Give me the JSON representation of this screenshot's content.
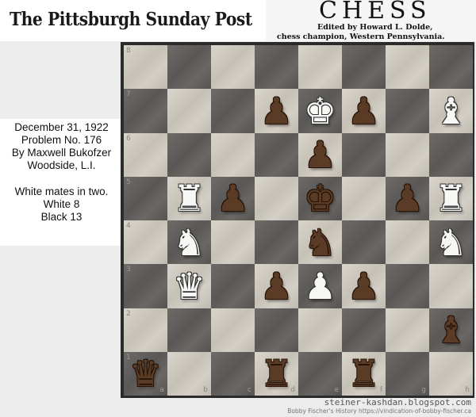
{
  "header": {
    "masthead": "The Pittsburgh Sunday Post",
    "chess_title": "CHESS",
    "edited_by": "Edited by Howard L. Dolde,",
    "champion": "chess champion, Western Pennsylvania."
  },
  "problem": {
    "date": "December 31, 1922",
    "number": "Problem No. 176",
    "author": "By Maxwell Bukofzer",
    "location": "Woodside, L.I.",
    "stipulation": "White mates in two.",
    "white_count": "White 8",
    "black_count": "Black 13"
  },
  "board": {
    "rank_labels": [
      "8",
      "7",
      "6",
      "5",
      "4",
      "3",
      "2",
      "1"
    ],
    "file_labels": [
      "a",
      "b",
      "c",
      "d",
      "e",
      "f",
      "g",
      "h"
    ],
    "light_color": "#d0ccc2",
    "dark_color": "#63605d",
    "pieces": [
      {
        "square": "d7",
        "color": "black",
        "type": "pawn",
        "glyph": "♟"
      },
      {
        "square": "e7",
        "color": "white",
        "type": "king",
        "glyph": "♚"
      },
      {
        "square": "f7",
        "color": "black",
        "type": "pawn",
        "glyph": "♟"
      },
      {
        "square": "h7",
        "color": "white",
        "type": "bishop",
        "glyph": "♝"
      },
      {
        "square": "e6",
        "color": "black",
        "type": "pawn",
        "glyph": "♟"
      },
      {
        "square": "b5",
        "color": "white",
        "type": "rook",
        "glyph": "♜"
      },
      {
        "square": "c5",
        "color": "black",
        "type": "pawn",
        "glyph": "♟"
      },
      {
        "square": "e5",
        "color": "black",
        "type": "king",
        "glyph": "♚"
      },
      {
        "square": "g5",
        "color": "black",
        "type": "pawn",
        "glyph": "♟"
      },
      {
        "square": "h5",
        "color": "white",
        "type": "rook",
        "glyph": "♜"
      },
      {
        "square": "b4",
        "color": "white",
        "type": "knight",
        "glyph": "♞"
      },
      {
        "square": "e4",
        "color": "black",
        "type": "knight",
        "glyph": "♞"
      },
      {
        "square": "h4",
        "color": "white",
        "type": "knight",
        "glyph": "♞"
      },
      {
        "square": "b3",
        "color": "white",
        "type": "queen",
        "glyph": "♛"
      },
      {
        "square": "d3",
        "color": "black",
        "type": "pawn",
        "glyph": "♟"
      },
      {
        "square": "e3",
        "color": "white",
        "type": "pawn",
        "glyph": "♟"
      },
      {
        "square": "f3",
        "color": "black",
        "type": "pawn",
        "glyph": "♟"
      },
      {
        "square": "h2",
        "color": "black",
        "type": "bishop",
        "glyph": "♝"
      },
      {
        "square": "a1",
        "color": "black",
        "type": "queen",
        "glyph": "♛"
      },
      {
        "square": "d1",
        "color": "black",
        "type": "rook",
        "glyph": "♜"
      },
      {
        "square": "f1",
        "color": "black",
        "type": "rook",
        "glyph": "♜"
      }
    ]
  },
  "footer": {
    "blog": "steiner-kashdan.blogspot.com",
    "history": "Bobby Fischer's History https://vindication-of-bobby-fischer.ca"
  }
}
